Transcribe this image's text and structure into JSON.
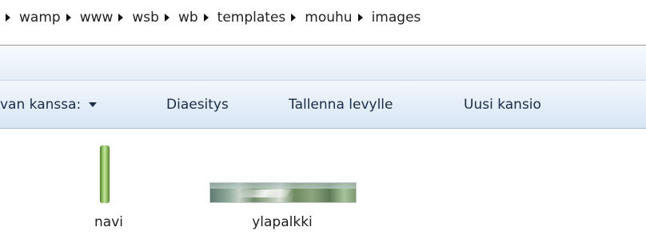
{
  "breadcrumb": {
    "items": [
      {
        "label": "wamp"
      },
      {
        "label": "www"
      },
      {
        "label": "wsb"
      },
      {
        "label": "wb"
      },
      {
        "label": "templates"
      },
      {
        "label": "mouhu"
      },
      {
        "label": "images"
      }
    ]
  },
  "toolbar": {
    "share_label": "van kanssa:",
    "slideshow_label": "Diaesitys",
    "burn_label": "Tallenna levylle",
    "new_folder_label": "Uusi kansio"
  },
  "files": [
    {
      "name": "navi"
    },
    {
      "name": "ylapalkki"
    }
  ]
}
